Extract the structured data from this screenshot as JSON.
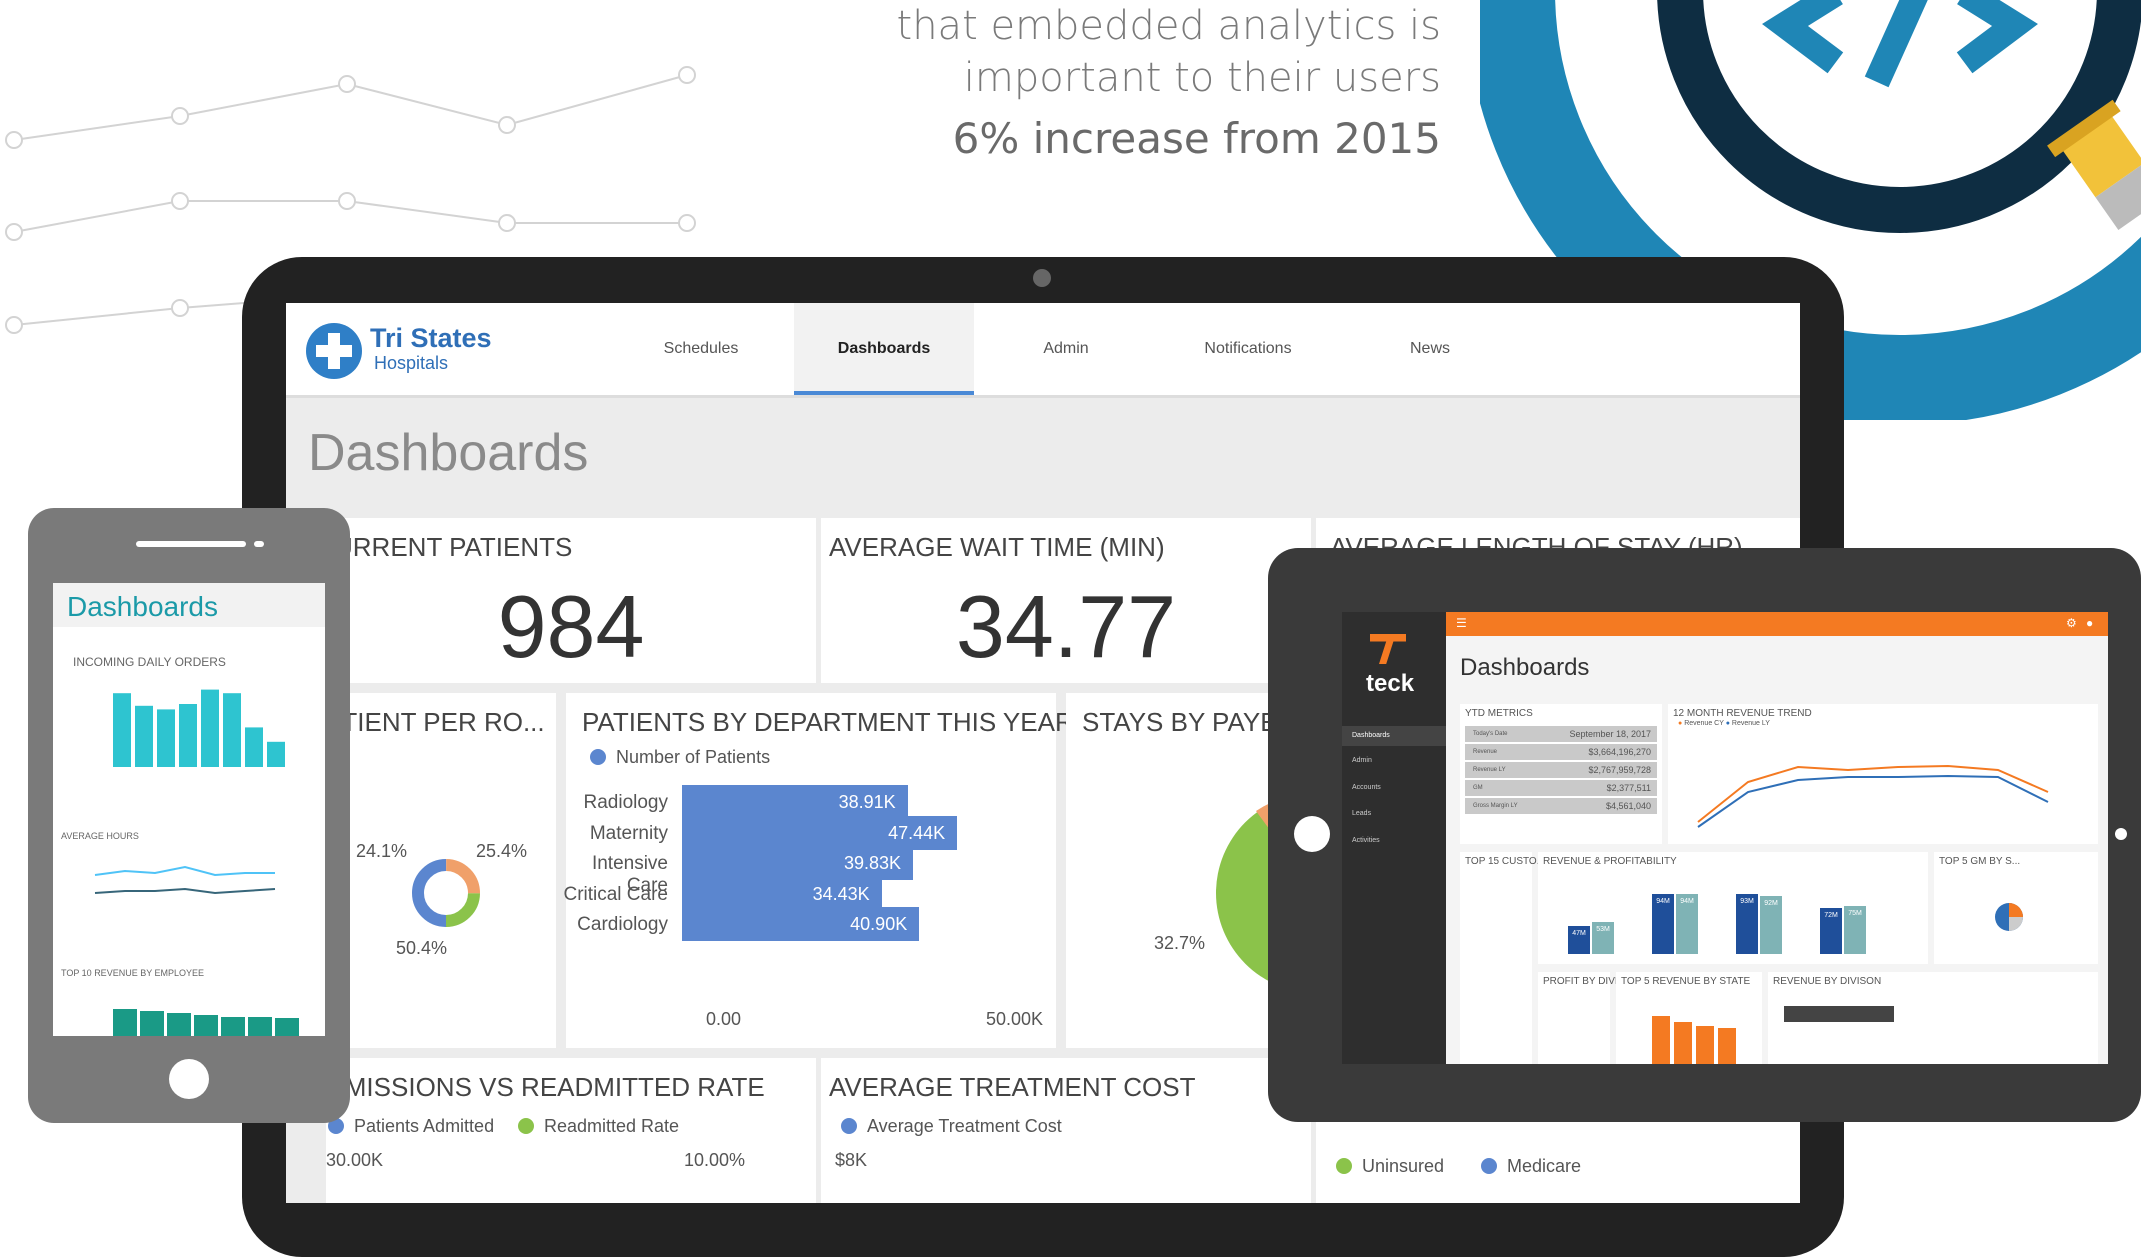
{
  "hero": {
    "line1": "that embedded analytics is",
    "line2": "important to their users",
    "stat": "6% increase from 2015"
  },
  "app": {
    "brand_title": "Tri States",
    "brand_subtitle": "Hospitals",
    "nav": [
      "Schedules",
      "Dashboards",
      "Admin",
      "Notifications",
      "News"
    ],
    "active_nav": "Dashboards",
    "page_title": "Dashboards"
  },
  "kpis": {
    "current_patients_title": "URRENT PATIENTS",
    "current_patients_value": "984",
    "wait_time_title": "AVERAGE WAIT TIME (MIN)",
    "wait_time_value": "34.77",
    "length_of_stay_title": "AVERAGE LENGTH OF STAY (HR)"
  },
  "panels": {
    "patient_per_room_title": "ATIENT PER RO...",
    "donut_labels": [
      "24.1%",
      "25.4%",
      "50.4%"
    ],
    "department_title": "PATIENTS BY DEPARTMENT THIS YEAR",
    "department_legend": "Number of Patients",
    "stays_title": "STAYS BY PAYER",
    "stays_label": "32.7%",
    "admissions_title": "DMISSIONS VS READMITTED RATE",
    "admissions_legend": [
      "Patients Admitted",
      "Readmitted Rate"
    ],
    "admissions_y_left": "30.00K",
    "admissions_y_right": "10.00%",
    "treatment_title": "AVERAGE TREATMENT COST",
    "treatment_legend": "Average Treatment Cost",
    "treatment_y": "$8K",
    "payer_legend": [
      "Uninsured",
      "Medicare"
    ]
  },
  "chart_data": {
    "type": "bar",
    "title": "PATIENTS BY DEPARTMENT THIS YEAR",
    "categories": [
      "Radiology",
      "Maternity",
      "Intensive Care",
      "Critical Care",
      "Cardiology"
    ],
    "values": [
      38.91,
      47.44,
      39.83,
      34.43,
      40.9
    ],
    "value_labels": [
      "38.91K",
      "47.44K",
      "39.83K",
      "34.43K",
      "40.90K"
    ],
    "xlim": [
      0,
      50
    ],
    "x_ticks": [
      "0.00",
      "50.00K"
    ],
    "series": [
      {
        "name": "Number of Patients",
        "values": [
          38.91,
          47.44,
          39.83,
          34.43,
          40.9
        ]
      }
    ]
  },
  "phone": {
    "title": "Dashboards",
    "chart1_title": "INCOMING DAILY ORDERS",
    "chart2_title": "AVERAGE HOURS",
    "chart3_title": "TOP 10 REVENUE BY EMPLOYEE",
    "bars": [
      0.82,
      0.68,
      0.64,
      0.7,
      0.86,
      0.82,
      0.44,
      0.28
    ]
  },
  "teck": {
    "logo": "teck",
    "title": "Dashboards",
    "side_items": [
      "Dashboards",
      "Admin",
      "Accounts",
      "Leads",
      "Activities"
    ],
    "ytd_title": "YTD METRICS",
    "metrics": [
      {
        "label": "Today's Date",
        "value": "September 18, 2017"
      },
      {
        "label": "Revenue",
        "value": "$3,664,196,270"
      },
      {
        "label": "Revenue LY",
        "value": "$2,767,959,728"
      },
      {
        "label": "GM",
        "value": "$2,377,511"
      },
      {
        "label": "Gross Margin LY",
        "value": "$4,561,040"
      }
    ],
    "trend_title": "12 MONTH REVENUE TREND",
    "trend_legend": [
      "Revenue CY",
      "Revenue LY"
    ],
    "customers_title": "TOP 15 CUSTO...",
    "profit_title": "REVENUE & PROFITABILITY",
    "gm_title": "TOP 5 GM BY S...",
    "profit_div_title": "PROFIT BY DIVI...",
    "state_title": "TOP 5 REVENUE BY STATE",
    "division_title": "REVENUE BY DIVISON",
    "bar_labels": [
      "47M",
      "53M",
      "94M",
      "94M",
      "93M",
      "92M",
      "72M",
      "75M"
    ]
  },
  "colors": {
    "accent_blue": "#4a89d6",
    "bar_blue": "#5b86cf",
    "teck_orange": "#f47a22",
    "teal": "#2ec4d0",
    "ring_blue": "#1f86b6",
    "ring_dark": "#0e2d42"
  }
}
